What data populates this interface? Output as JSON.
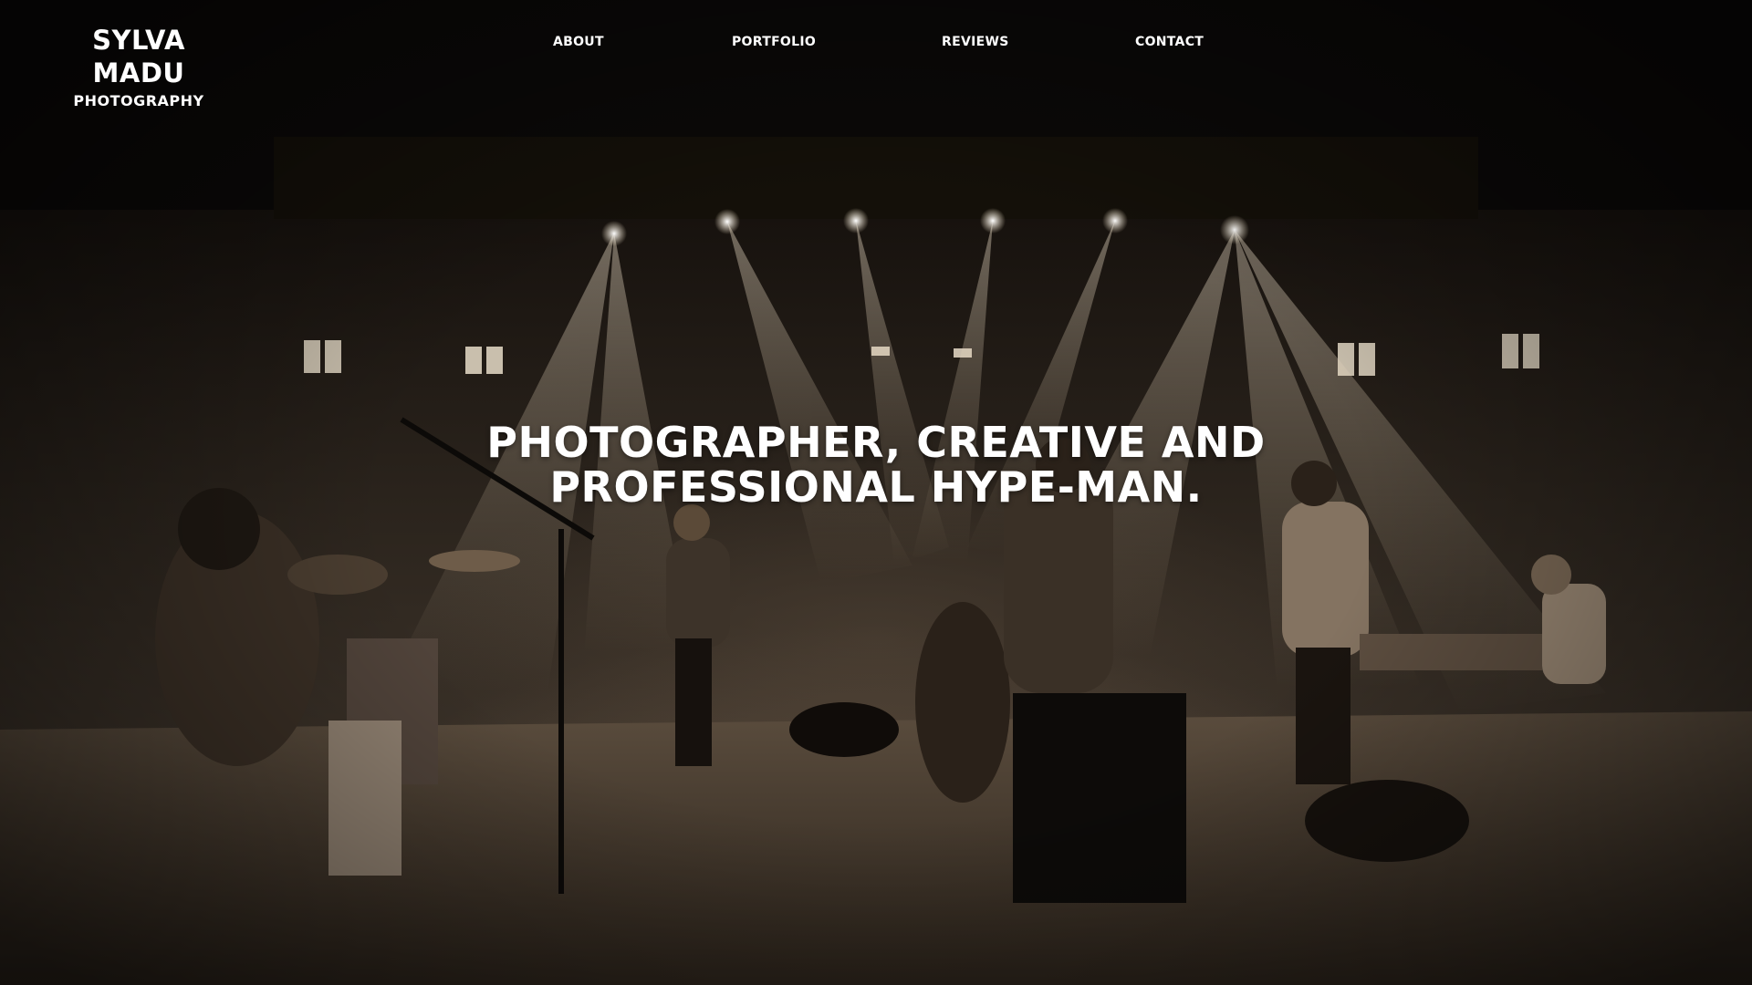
{
  "brand": {
    "name": "SYLVA MADU",
    "subtitle": "PHOTOGRAPHY"
  },
  "nav": {
    "items": [
      {
        "label": "ABOUT"
      },
      {
        "label": "PORTFOLIO"
      },
      {
        "label": "REVIEWS"
      },
      {
        "label": "CONTACT"
      }
    ]
  },
  "hero": {
    "headline_line1": "PHOTOGRAPHER, CREATIVE AND",
    "headline_line2": "PROFESSIONAL HYPE-MAN.",
    "background_image": "concert-stage-photo",
    "text_color": "#ffffff",
    "tone": "sepia"
  }
}
